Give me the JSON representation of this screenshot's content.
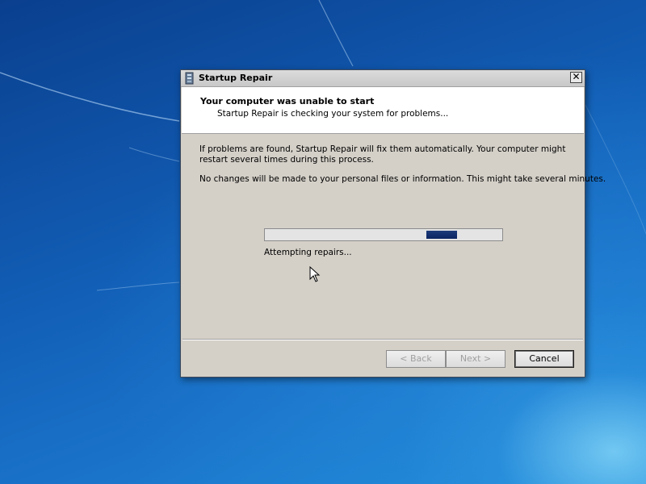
{
  "window": {
    "title": "Startup Repair",
    "close_symbol": "✕"
  },
  "header": {
    "title": "Your computer was unable to start",
    "subtitle": "Startup Repair is checking your system for problems..."
  },
  "body": {
    "paragraph1": "If problems are found, Startup Repair will fix them automatically. Your computer might restart several times during this process.",
    "paragraph2": "No changes will be made to your personal files or information. This might take several minutes."
  },
  "progress": {
    "status": "Attempting repairs...",
    "marquee_position": 0.68,
    "marquee_length": 0.13
  },
  "buttons": {
    "back": "< Back",
    "next": "Next >",
    "cancel": "Cancel"
  },
  "colors": {
    "progress_fill": "#0a2460",
    "dialog_background": "#d4d0c8",
    "desktop": "#125fb7"
  },
  "icons": {
    "title": "startup-repair-icon",
    "close": "close-icon",
    "cursor": "mouse-pointer-icon"
  }
}
